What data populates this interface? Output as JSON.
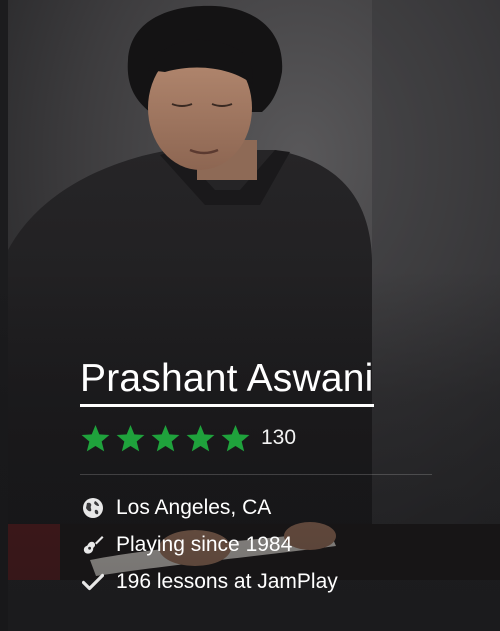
{
  "instructor": {
    "name": "Prashant Aswani",
    "rating_stars": 5,
    "rating_count": "130",
    "location": "Los Angeles, CA",
    "playing_since": "Playing since 1984",
    "lessons": "196 lessons at JamPlay"
  },
  "icons": {
    "star": "star-icon",
    "location": "globe-icon",
    "playing": "guitar-icon",
    "lessons": "check-icon"
  },
  "colors": {
    "star": "#1fa23c",
    "text": "#ffffff",
    "background": "#2b2b2d"
  }
}
